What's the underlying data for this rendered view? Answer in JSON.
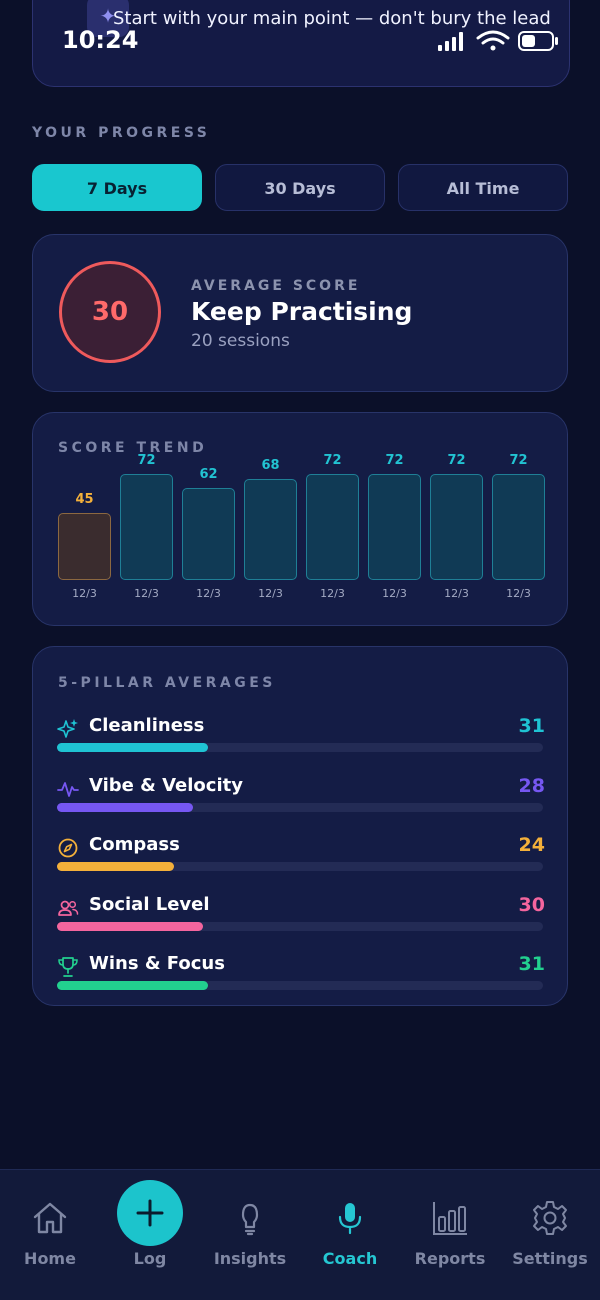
{
  "status": {
    "time": "10:24"
  },
  "tip": {
    "icon": "sparkle-icon",
    "text": "Start with your main point — don't bury the lead"
  },
  "progress": {
    "heading": "YOUR PROGRESS",
    "tabs": [
      {
        "label": "7 Days",
        "active": true
      },
      {
        "label": "30 Days",
        "active": false
      },
      {
        "label": "All Time",
        "active": false
      }
    ]
  },
  "average": {
    "score": "30",
    "label": "AVERAGE SCORE",
    "title": "Keep Practising",
    "sessions": "20 sessions"
  },
  "trend": {
    "heading": "SCORE TREND",
    "chart_data": {
      "type": "bar",
      "categories": [
        "12/3",
        "12/3",
        "12/3",
        "12/3",
        "12/3",
        "12/3",
        "12/3",
        "12/3"
      ],
      "values": [
        45,
        72,
        62,
        68,
        72,
        72,
        72,
        72
      ],
      "highlight_index": 0,
      "colors": {
        "highlight": "#f4b03a",
        "normal": "#22c3d2"
      }
    }
  },
  "pillars": {
    "heading": "5-PILLAR AVERAGES",
    "max": 100,
    "items": [
      {
        "name": "Cleanliness",
        "value": "31",
        "score": 31,
        "color": "#1fc3d3",
        "icon": "sparkles-icon"
      },
      {
        "name": "Vibe & Velocity",
        "value": "28",
        "score": 28,
        "color": "#7657f2",
        "icon": "pulse-icon"
      },
      {
        "name": "Compass",
        "value": "24",
        "score": 24,
        "color": "#f4b03a",
        "icon": "compass-icon"
      },
      {
        "name": "Social Level",
        "value": "30",
        "score": 30,
        "color": "#f4659e",
        "icon": "users-icon"
      },
      {
        "name": "Wins & Focus",
        "value": "31",
        "score": 31,
        "color": "#22d08f",
        "icon": "trophy-icon"
      }
    ]
  },
  "nav": {
    "items": [
      {
        "label": "Home",
        "icon": "home-icon"
      },
      {
        "label": "Log",
        "icon": "plus-icon"
      },
      {
        "label": "Insights",
        "icon": "lightbulb-icon"
      },
      {
        "label": "Coach",
        "icon": "microphone-icon",
        "active": true
      },
      {
        "label": "Reports",
        "icon": "bar-chart-icon"
      },
      {
        "label": "Settings",
        "icon": "gear-icon"
      }
    ]
  }
}
